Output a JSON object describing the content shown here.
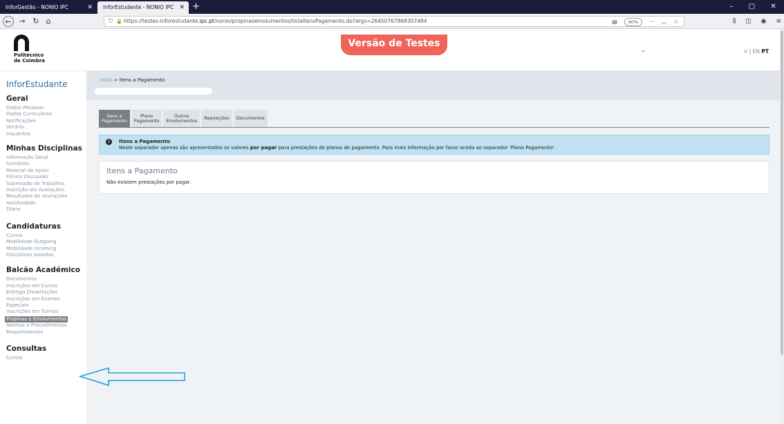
{
  "browser": {
    "tabs": [
      {
        "label": "InforGestão - NONIO IPC"
      },
      {
        "label": "InforEstudante - NONIO IPC"
      }
    ],
    "url_prefix": "https://testes-inforestudante.",
    "url_domain": "ipc.pt",
    "url_suffix": "/nonio/propinasemolumentos/listaItensPagamento.do?args=26450767868307484",
    "zoom": "90%"
  },
  "header": {
    "logo_line1": "Politécnico",
    "logo_line2": "de Coimbra",
    "test_badge": "Versão de Testes",
    "lang_exit": "ir",
    "lang_en": "EN",
    "lang_pt": "PT"
  },
  "sidebar": {
    "app_name": "InforEstudante",
    "sections": [
      {
        "title": "Geral",
        "items": [
          "Dados Pessoais",
          "Dados Curriculares",
          "Notificações",
          "Horário",
          "Inquéritos"
        ]
      },
      {
        "title": "Minhas Disciplinas",
        "items": [
          "Informação Geral",
          "Sumários",
          "Material de Apoio",
          "Fóruns Discussão",
          "Submissão de Trabalhos",
          "Inscrição em Avaliações",
          "Resultados de Avaliações",
          "Assiduidade",
          "Diário"
        ]
      },
      {
        "title": "Candidaturas",
        "items": [
          "Cursos",
          "Mobilidade Outgoing",
          "Mobilidade Incoming",
          "Disciplinas Isoladas"
        ]
      },
      {
        "title": "Balcão Académico",
        "items": [
          "Documentos",
          "Inscrições em Cursos",
          "Entrega Dissertações",
          "Inscrições em Exames",
          "Especiais",
          "Inscrições em Turmas",
          "Propinas e Emolumentos",
          "Normas e Procedimentos",
          "Requerimentos"
        ]
      },
      {
        "title": "Consultas",
        "items": [
          "Cursos"
        ]
      }
    ]
  },
  "main": {
    "breadcrumb_home": "Início",
    "breadcrumb_sep": ">",
    "breadcrumb_current": "Itens a Pagamento",
    "tabs": [
      {
        "label": "Itens a\nPagamento"
      },
      {
        "label": "Plano\nPagamento"
      },
      {
        "label": "Outros\nEmolumentos"
      },
      {
        "label": "Reposições"
      },
      {
        "label": "Documentos"
      }
    ],
    "alert": {
      "title": "Itens a Pagamento",
      "text_before": "Neste separador apenas são apresentados os valores ",
      "text_bold": "por pagar",
      "text_after": " para prestações de planos de pagamento. Para mais informação por favor aceda ao separador 'Plano Pagamento'."
    },
    "panel": {
      "title": "Itens a Pagamento",
      "text": "Não existem prestações por pagar."
    }
  },
  "colors": {
    "accent": "#2b6aa6",
    "badge": "#f0645a",
    "annotation_arrow": "#1e9fe0"
  }
}
